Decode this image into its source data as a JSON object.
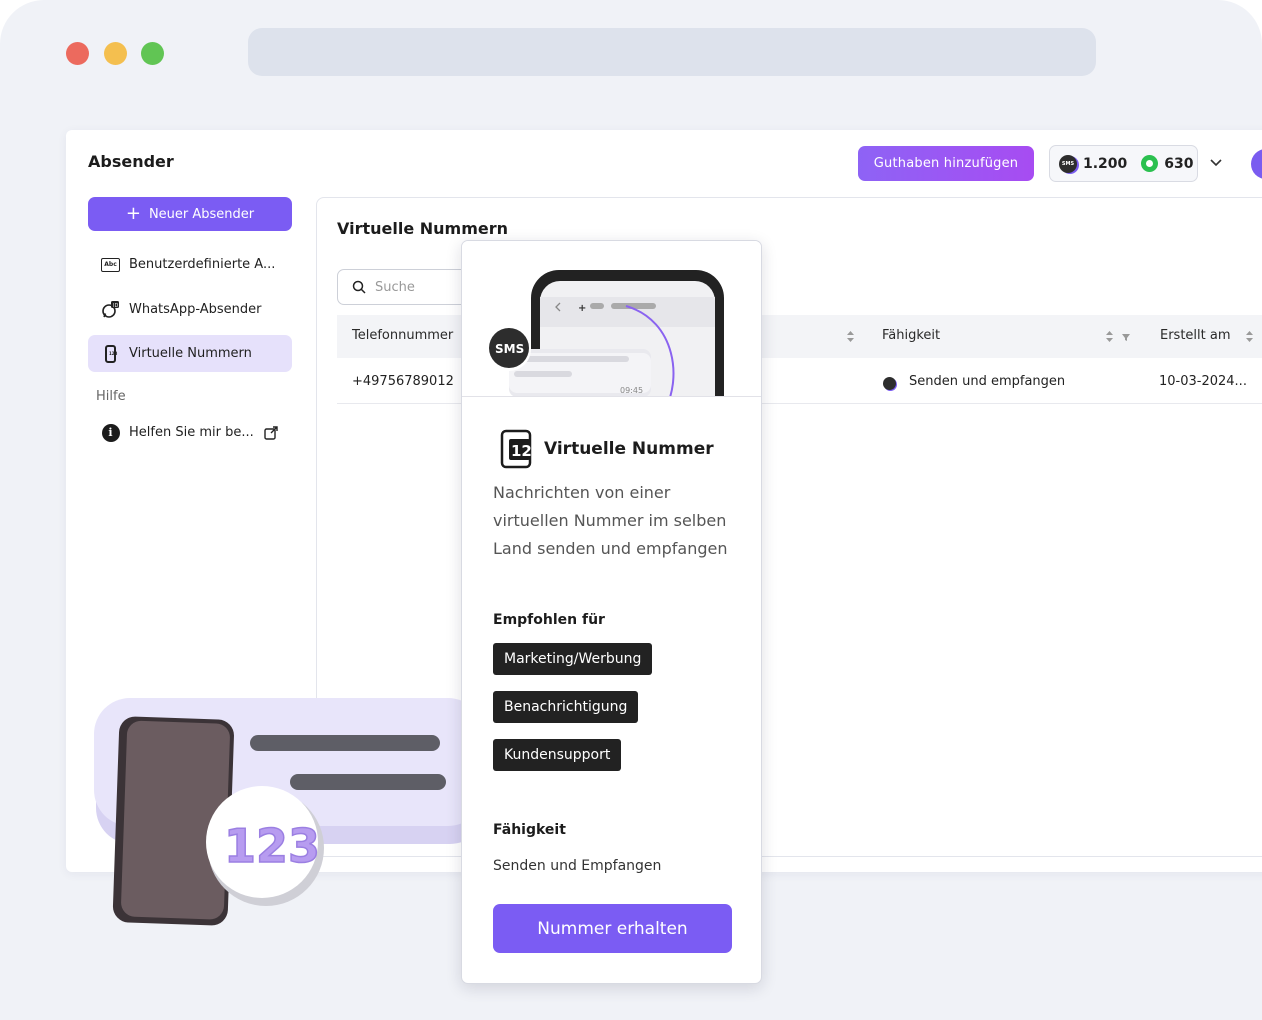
{
  "app": {
    "title": "Absender",
    "add_credit_label": "Guthaben hinzufügen",
    "balance": {
      "sms_icon": "sms-icon",
      "sms_count": "1.200",
      "whatsapp_icon": "whatsapp-icon",
      "whatsapp_count": "630"
    }
  },
  "sidebar": {
    "new_sender_label": "Neuer Absender",
    "items": [
      {
        "label": "Benutzerdefinierte A...",
        "icon": "abc-icon"
      },
      {
        "label": "WhatsApp-Absender",
        "icon": "whatsapp-id-icon"
      },
      {
        "label": "Virtuelle Nummern",
        "icon": "phone-number-icon",
        "active": true
      }
    ],
    "help_section": "Hilfe",
    "help_items": [
      {
        "label": "Helfen Sie mir be...",
        "icon": "info-icon"
      }
    ]
  },
  "main": {
    "title": "Virtuelle Nummern",
    "search_placeholder": "Suche",
    "columns": [
      "Telefonnummer",
      "Fähigkeit",
      "Erstellt am"
    ],
    "rows": [
      {
        "phone": "+49756789012",
        "capability": "Senden und empfangen",
        "created": "10-03-2024..."
      }
    ]
  },
  "popup": {
    "hero": {
      "badge": "SMS",
      "time": "09:45"
    },
    "title": "Virtuelle Nummer",
    "icon_number": "12",
    "description": "Nachrichten von einer virtuellen Nummer im selben Land senden und empfangen",
    "recommended_heading": "Empfohlen für",
    "tags": [
      "Marketing/Werbung",
      "Benachrichtigung",
      "Kundensupport"
    ],
    "capability_heading": "Fähigkeit",
    "capability_value": "Senden und Empfangen",
    "cta_label": "Nummer erhalten"
  },
  "illustration": {
    "number": "123"
  },
  "colors": {
    "accent": "#7b5cf3",
    "background": "#f0f2f7",
    "active_nav": "#e6e1fb"
  }
}
